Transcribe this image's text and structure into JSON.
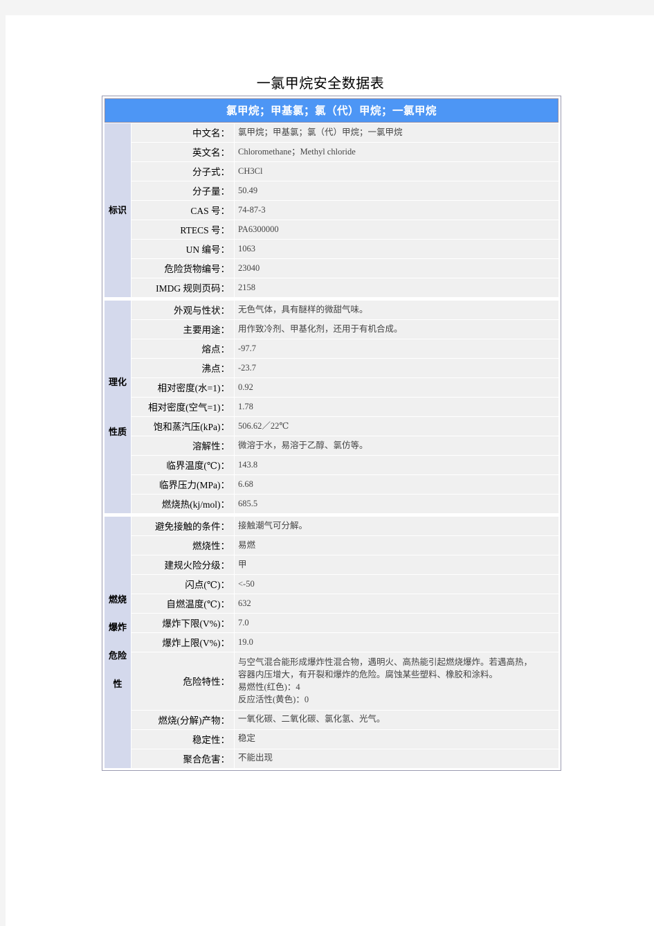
{
  "document": {
    "title": "一氯甲烷安全数据表",
    "table_header": "氯甲烷；甲基氯；氯（代）甲烷；一氯甲烷"
  },
  "sections": [
    {
      "category": "标识",
      "rows": [
        {
          "label": "中文名：",
          "value": "氯甲烷；甲基氯；氯（代）甲烷；一氯甲烷"
        },
        {
          "label": "英文名：",
          "value": "Chloromethane；Methyl chloride"
        },
        {
          "label": "分子式：",
          "value": "CH3Cl"
        },
        {
          "label": "分子量：",
          "value": "50.49"
        },
        {
          "label": "CAS 号：",
          "value": "74-87-3"
        },
        {
          "label": "RTECS 号：",
          "value": "PA6300000"
        },
        {
          "label": "UN 编号：",
          "value": "1063"
        },
        {
          "label": "危险货物编号：",
          "value": "23040"
        },
        {
          "label": "IMDG 规则页码：",
          "value": "2158"
        }
      ]
    },
    {
      "category": "理化性质",
      "rows": [
        {
          "label": "外观与性状：",
          "value": "无色气体，具有醚样的微甜气味。"
        },
        {
          "label": "主要用途：",
          "value": "用作致冷剂、甲基化剂，还用于有机合成。"
        },
        {
          "label": "熔点：",
          "value": "-97.7"
        },
        {
          "label": "沸点：",
          "value": "-23.7"
        },
        {
          "label": "相对密度(水=1)：",
          "value": "0.92"
        },
        {
          "label": "相对密度(空气=1)：",
          "value": "1.78"
        },
        {
          "label": "饱和蒸汽压(kPa)：",
          "value": "506.62／22℃"
        },
        {
          "label": "溶解性：",
          "value": "微溶于水，易溶于乙醇、氯仿等。"
        },
        {
          "label": "临界温度(℃)：",
          "value": "143.8"
        },
        {
          "label": "临界压力(MPa)：",
          "value": "6.68"
        },
        {
          "label": "燃烧热(kj/mol)：",
          "value": "685.5"
        }
      ]
    },
    {
      "category": "燃烧爆炸危险性",
      "rows": [
        {
          "label": "避免接触的条件：",
          "value": "接触潮气可分解。"
        },
        {
          "label": "燃烧性：",
          "value": "易燃"
        },
        {
          "label": "建规火险分级：",
          "value": "甲"
        },
        {
          "label": "闪点(℃)：",
          "value": "<-50"
        },
        {
          "label": "自燃温度(℃)：",
          "value": "632"
        },
        {
          "label": "爆炸下限(V%)：",
          "value": "7.0"
        },
        {
          "label": "爆炸上限(V%)：",
          "value": "19.0"
        },
        {
          "label": "危险特性：",
          "lines": [
            "与空气混合能形成爆炸性混合物，遇明火、高热能引起燃烧爆炸。若遇高热，",
            "容器内压增大，有开裂和爆炸的危险。腐蚀某些塑料、橡胶和涂料。",
            "易燃性(红色)：4",
            "反应活性(黄色)：0"
          ]
        },
        {
          "label": "燃烧(分解)产物：",
          "value": "一氧化碳、二氧化碳、氯化氢、光气。"
        },
        {
          "label": "稳定性：",
          "value": "稳定"
        },
        {
          "label": "聚合危害：",
          "value": "不能出现"
        }
      ]
    }
  ],
  "colors": {
    "header_blue": "#4d96f5",
    "category_bg": "#d4d9ec",
    "cell_bg": "#f0f0f0",
    "border": "#9a9ab0"
  }
}
